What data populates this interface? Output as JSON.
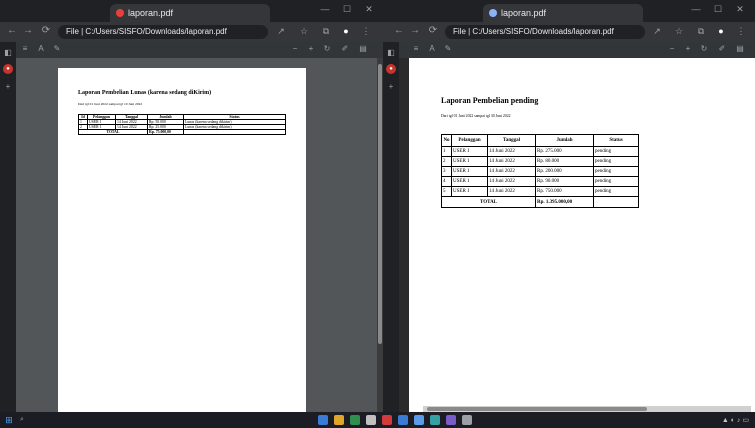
{
  "left_window": {
    "tab_title": "laporan.pdf",
    "address": "File  |  C:/Users/SISFO/Downloads/laporan.pdf",
    "document": {
      "title": "Laporan Pembelian Lunas (karena sedang diKirim)",
      "subtitle": "Dari tgl 01 Juni 2022 sampai tgl 10 Juni 2022",
      "headers": [
        "Id",
        "Pelanggan",
        "Tanggal",
        "Jumlah",
        "Status"
      ],
      "rows": [
        [
          "1",
          "USER 1",
          "14 Juni 2022",
          "Rp. 50.000",
          "Lunas (karena sedang dikirim)"
        ],
        [
          "2",
          "USER 1",
          "14 Juni 2022",
          "Rp. 25.000",
          "Lunas (karena sedang dikirim)"
        ]
      ],
      "total_label": "TOTAL",
      "total_value": "Rp. 75.000,00"
    }
  },
  "right_window": {
    "tab_title": "laporan.pdf",
    "address": "File  |  C:/Users/SISFO/Downloads/laporan.pdf",
    "document": {
      "title": "Laporan Pembelian pending",
      "subtitle": "Dari tgl 01 Juni 2022 sampai tgl 30 Juni 2022",
      "headers": [
        "No",
        "Pelanggan",
        "Tanggal",
        "Jumlah",
        "Status"
      ],
      "rows": [
        [
          "1",
          "USER 1",
          "14 Juni 2022",
          "Rp. 275.000",
          "pending"
        ],
        [
          "2",
          "USER 1",
          "14 Juni 2022",
          "Rp. 80.000",
          "pending"
        ],
        [
          "3",
          "USER 1",
          "14 Juni 2022",
          "Rp. 200.000",
          "pending"
        ],
        [
          "4",
          "USER 1",
          "14 Juni 2022",
          "Rp. 90.000",
          "pending"
        ],
        [
          "5",
          "USER 1",
          "14 Juni 2022",
          "Rp. 750.000",
          "pending"
        ]
      ],
      "total_label": "TOTAL",
      "total_value": "Rp. 1.395.000,00"
    }
  },
  "icons": {
    "back": "←",
    "forward": "→",
    "reload": "⟳",
    "close": "✕",
    "minimize": "—",
    "maximize": "☐",
    "star": "☆",
    "menu": "⋮",
    "share": "↗",
    "extension": "⧉"
  },
  "colors": {
    "chrome_dark": "#202124",
    "tab_active": "#35363a",
    "viewer_bg": "#525659",
    "favicon_left": "#e8413b",
    "favicon_right": "#8ab4f8"
  }
}
